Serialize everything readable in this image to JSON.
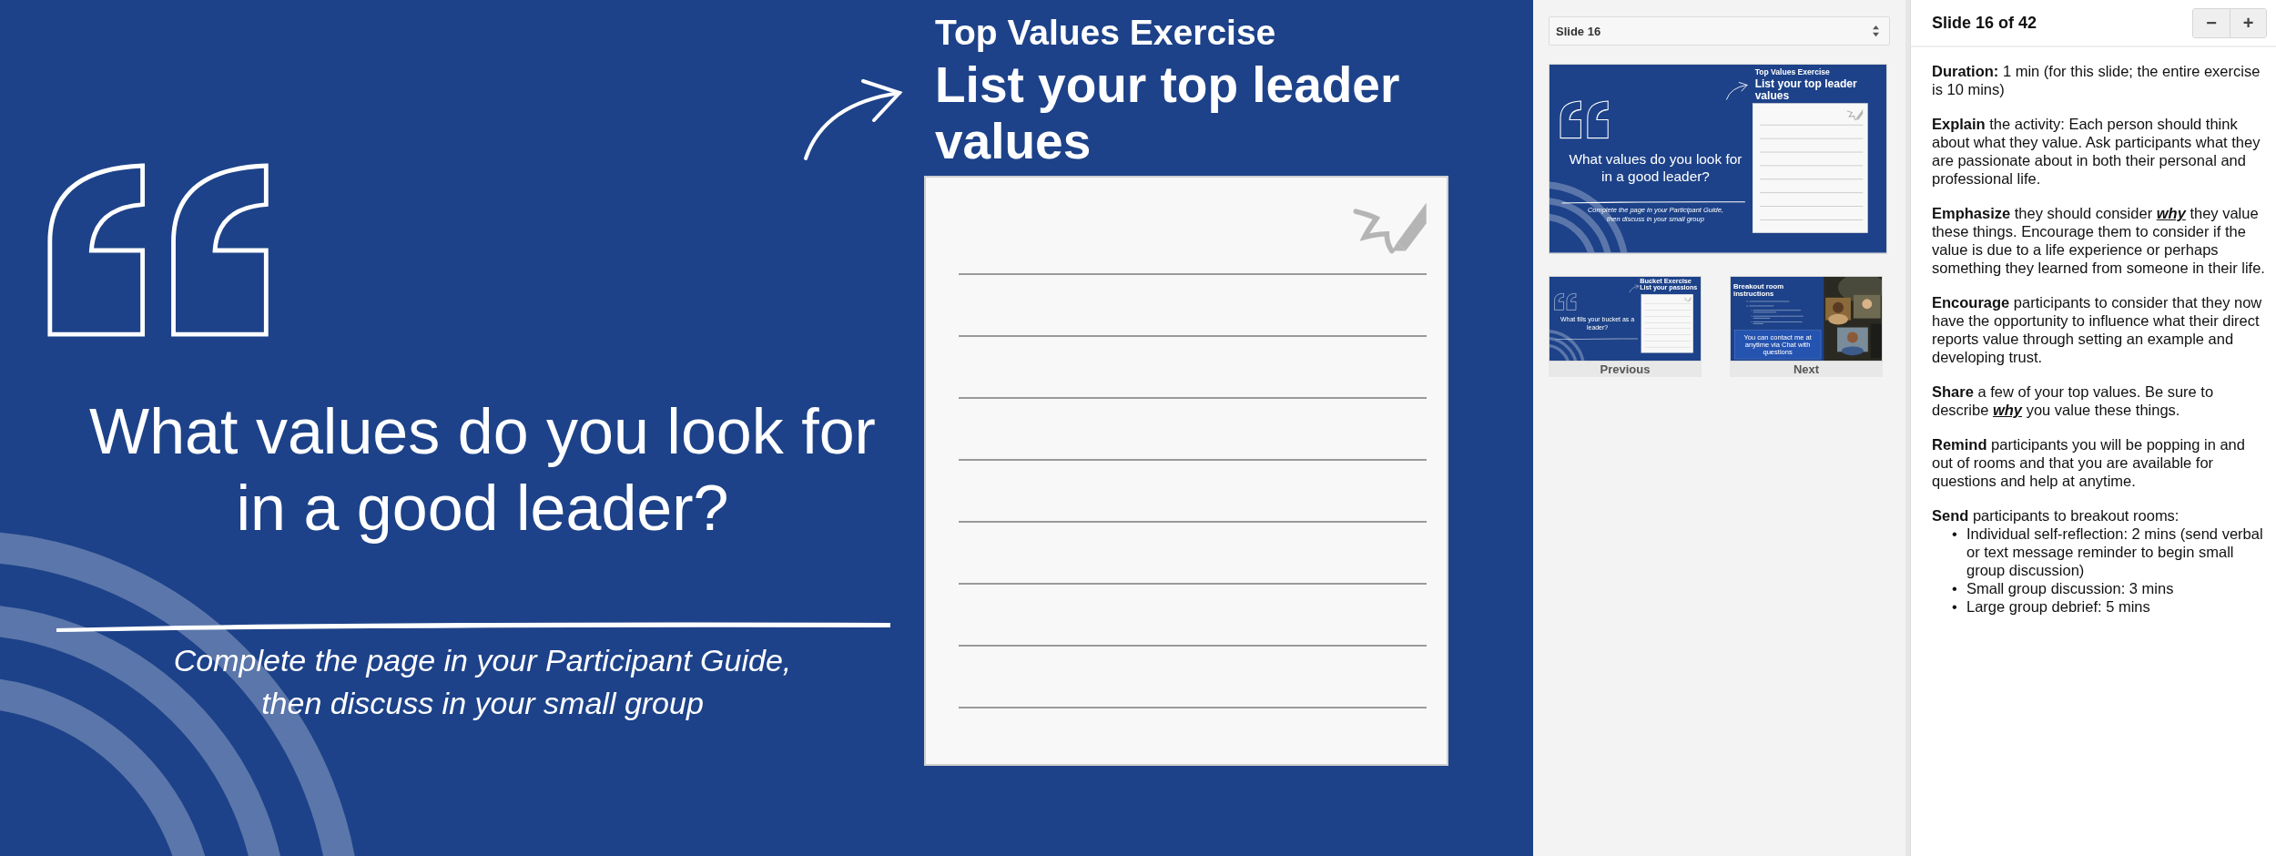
{
  "slide": {
    "kind": "exercise",
    "eyebrow": "Top Values Exercise",
    "title": "List your top leader values",
    "question": "What values do you look for in a good leader?",
    "subtitle": "Complete the page in your Participant Guide, then discuss in your small group"
  },
  "navigator": {
    "slide_select": "Slide 16",
    "current": {
      "kind": "exercise",
      "eyebrow": "Top Values Exercise",
      "title": "List your top leader values",
      "question": "What values do you look for in a good leader?",
      "subtitle": "Complete the page in your Participant Guide, then discuss in your small group"
    },
    "previous": {
      "label": "Previous",
      "slide": {
        "kind": "exercise",
        "eyebrow": "Bucket Exercise",
        "title": "List your passions",
        "question": "What fills your bucket as a leader?"
      }
    },
    "next": {
      "label": "Next",
      "slide": {
        "kind": "instructions",
        "title": "Breakout room instructions",
        "callout": "You can contact me at anytime via Chat with questions"
      }
    }
  },
  "notes": {
    "counter": "Slide 16 of 42",
    "zoom_buttons": [
      "−",
      "+"
    ],
    "paragraphs": [
      "**Duration:** 1 min (for this slide; the entire exercise is 10 mins)",
      "**Explain** the activity: Each person should think about what they value. Ask participants what they are passionate about in both their personal and professional life.",
      "**Emphasize** they should consider *why* they value these things. Encourage them to consider if the value is due to a life experience or perhaps something they learned from someone in their life.",
      "**Encourage** participants to consider that they now have the opportunity to influence what their direct reports value through setting an example and developing trust.",
      "**Share** a few of your top values. Be sure to describe *why* you value these things.",
      "**Remind** participants you will be popping in and out of rooms and that you are available for questions and help at anytime.",
      "**Send** participants to breakout rooms:"
    ],
    "bullets": [
      {
        "marker": "•",
        "text": "Individual self-reflection: 2 mins (send verbal or text message reminder to begin small group discussion)"
      },
      {
        "marker": "•",
        "text": "Small group discussion: 3 mins"
      },
      {
        "marker": "•",
        "text": "Large group debrief: 5 mins"
      }
    ]
  }
}
